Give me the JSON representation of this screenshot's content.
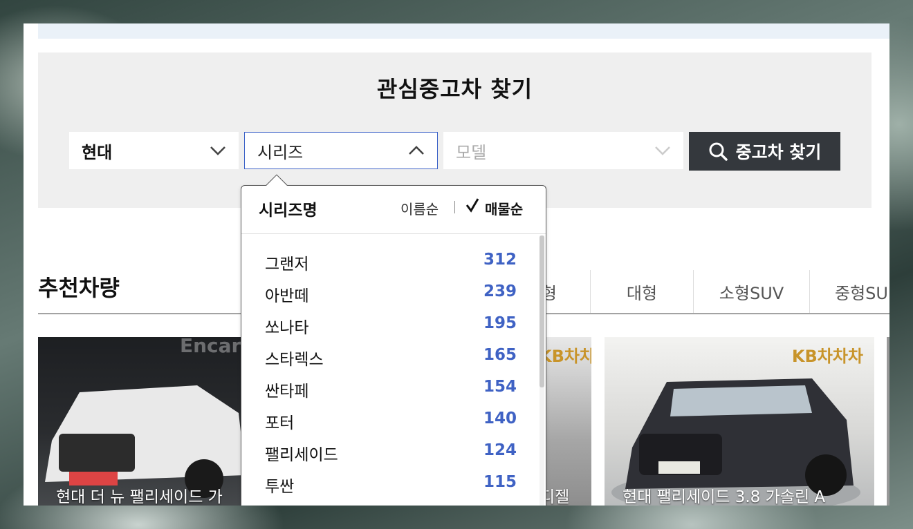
{
  "search": {
    "title": "관심중고차 찾기",
    "maker": "현대",
    "series": "시리즈",
    "model": "모델",
    "button": "중고차 찾기"
  },
  "dropdown": {
    "title": "시리즈명",
    "sort_name": "이름순",
    "sort_count": "매물순",
    "items": [
      {
        "name": "그랜저",
        "count": "312"
      },
      {
        "name": "아반떼",
        "count": "239"
      },
      {
        "name": "쏘나타",
        "count": "195"
      },
      {
        "name": "스타렉스",
        "count": "165"
      },
      {
        "name": "싼타페",
        "count": "154"
      },
      {
        "name": "포터",
        "count": "140"
      },
      {
        "name": "팰리세이드",
        "count": "124"
      },
      {
        "name": "투싼",
        "count": "115"
      }
    ]
  },
  "recommend": {
    "title": "추천차량",
    "tabs": [
      "형",
      "대형",
      "소형SUV",
      "중형SU"
    ]
  },
  "cards": [
    {
      "caption": "현대 더 뉴 팰리세이드 가",
      "logo": "Encar"
    },
    {
      "caption": "디젤",
      "logo": "KB차차"
    },
    {
      "caption": "현대 팰리세이드 3.8 가솔린 A",
      "logo": "KB차차차"
    }
  ],
  "colors": {
    "accent": "#3f62c4",
    "button_bg": "#34383d",
    "panel_bg": "#efefef"
  }
}
